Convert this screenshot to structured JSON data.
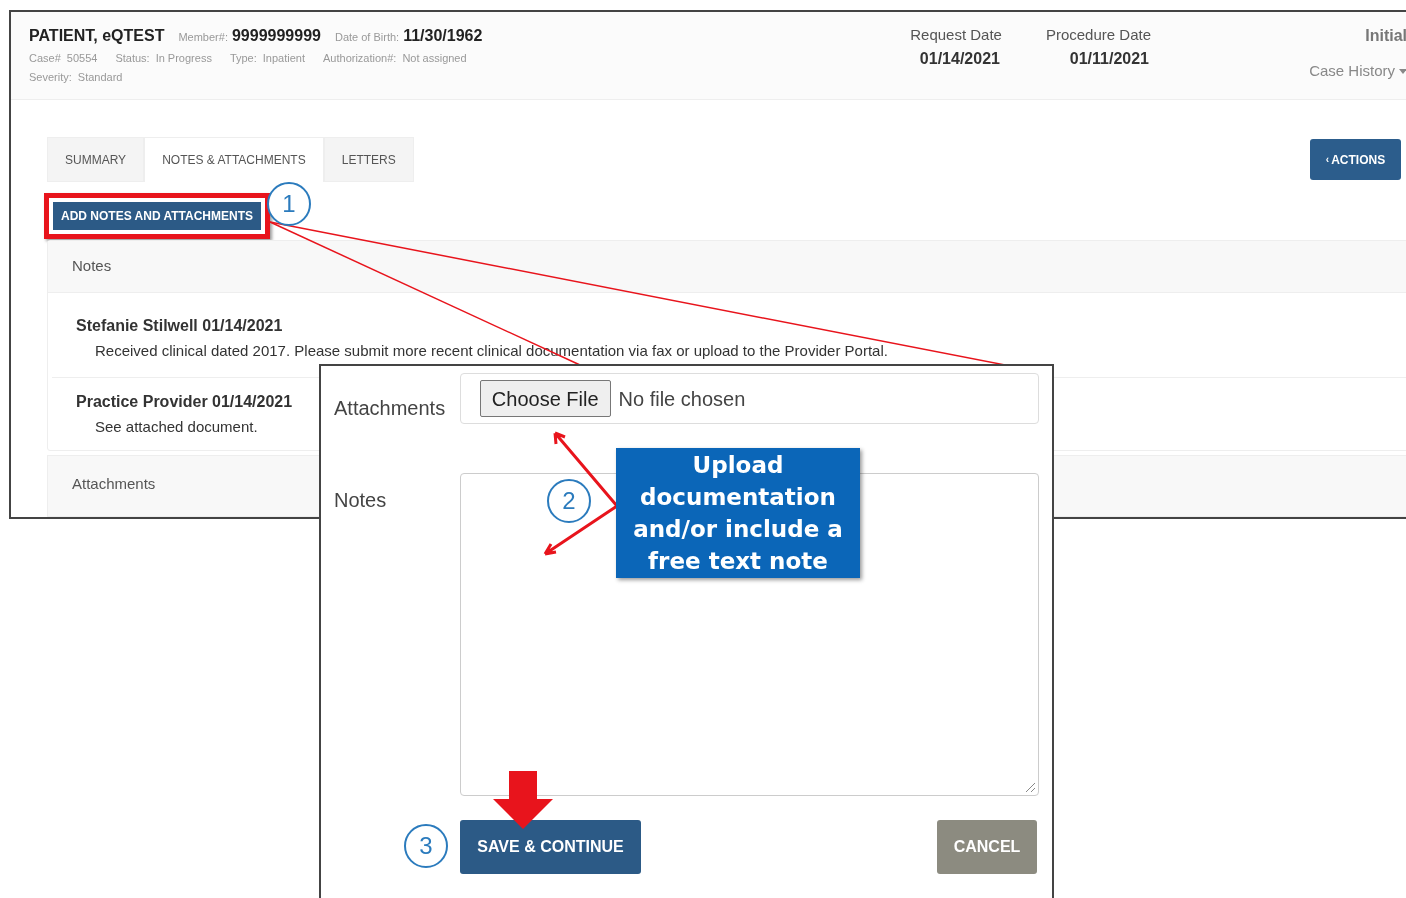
{
  "header": {
    "patient": "PATIENT, eQTEST",
    "fields": [
      {
        "label": "Member#:",
        "value": "9999999999"
      },
      {
        "label": "Date of Birth:",
        "value": "11/30/1962"
      }
    ],
    "details": [
      [
        {
          "label": "Case#",
          "value": "50554"
        },
        {
          "label": "Status:",
          "value": "In Progress"
        },
        {
          "label": "Type:",
          "value": "Inpatient"
        },
        {
          "label": "Authorization#:",
          "value": "Not assigned"
        }
      ],
      [
        {
          "label": "Severity:",
          "value": "Standard"
        }
      ]
    ],
    "dates": [
      {
        "label": "Request Date",
        "value": "01/14/2021"
      },
      {
        "label": "Procedure Date",
        "value": "01/11/2021"
      }
    ],
    "status": "Initial",
    "case_history": "Case History"
  },
  "tabs": [
    {
      "label": "SUMMARY",
      "selected": false
    },
    {
      "label": "NOTES & ATTACHMENTS",
      "selected": true
    },
    {
      "label": "LETTERS",
      "selected": false
    }
  ],
  "actions_button": {
    "icon": "‹",
    "label": "ACTIONS"
  },
  "add_button": "ADD NOTES AND ATTACHMENTS",
  "notes_section": {
    "title": "Notes",
    "notes": [
      {
        "author": "Stefanie Stilwell 01/14/2021",
        "text": "Received clinical dated 2017. Please submit more recent clinical documentation via fax or upload to the Provider Portal."
      },
      {
        "author": "Practice Provider 01/14/2021",
        "text": "See attached document."
      }
    ]
  },
  "attachments_section": {
    "title": "Attachments"
  },
  "dialog": {
    "attachments_label": "Attachments",
    "file_button": "Choose File",
    "file_status": "No file chosen",
    "notes_label": "Notes",
    "save_button": "SAVE & CONTINUE",
    "cancel_button": "CANCEL"
  },
  "annotations": {
    "steps": [
      "1",
      "2",
      "3"
    ],
    "callout": "Upload documentation and/or include a free text note"
  }
}
